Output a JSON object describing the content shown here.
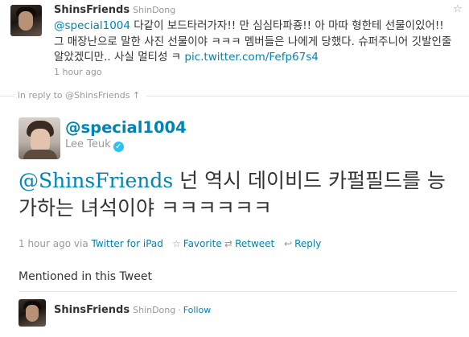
{
  "parent_tweet": {
    "screen_name": "ShinsFriends",
    "real_name": "ShinDong",
    "mention": "@special1004",
    "text_part1": "다같이 보드타러가자!! 만 심심타파죵!! 아 마따 형한테 선물이있어!! 그 매장난으로 말한 사진 선물이야 ㅋㅋㅋ 멤버들은 나에게 당했다. 슈퍼주니어 깃발인줄 알았겠디만.. 사실 멀티성 ㅋ ",
    "link": "pic.twitter.com/Fefp67s4",
    "time": "1 hour ago"
  },
  "in_reply_to": "in reply to @ShinsFriends ↑",
  "main_tweet": {
    "handle": "@special1004",
    "name": "Lee Teuk",
    "verified_glyph": "✓",
    "mention": "@ShinsFriends",
    "text": " 넌 역시 데이비드 카펄필드를 능가하는 녀석이야 ㅋㅋㅋㅋㅋㅋ",
    "time": "1 hour ago",
    "via": "via",
    "app": "Twitter for iPad",
    "actions": {
      "favorite": "Favorite",
      "retweet": "Retweet",
      "reply": "Reply"
    }
  },
  "mentioned": {
    "heading": "Mentioned in this Tweet",
    "screen_name": "ShinsFriends",
    "real_name": "ShinDong",
    "separator": "·",
    "follow": "Follow"
  },
  "icons": {
    "favorite": "star-icon",
    "retweet": "retweet-icon",
    "reply": "reply-icon",
    "verified": "verified-badge-icon"
  },
  "colors": {
    "link": "#0084b4",
    "muted": "#999999",
    "text": "#333333",
    "verified": "#2fc2ef"
  }
}
